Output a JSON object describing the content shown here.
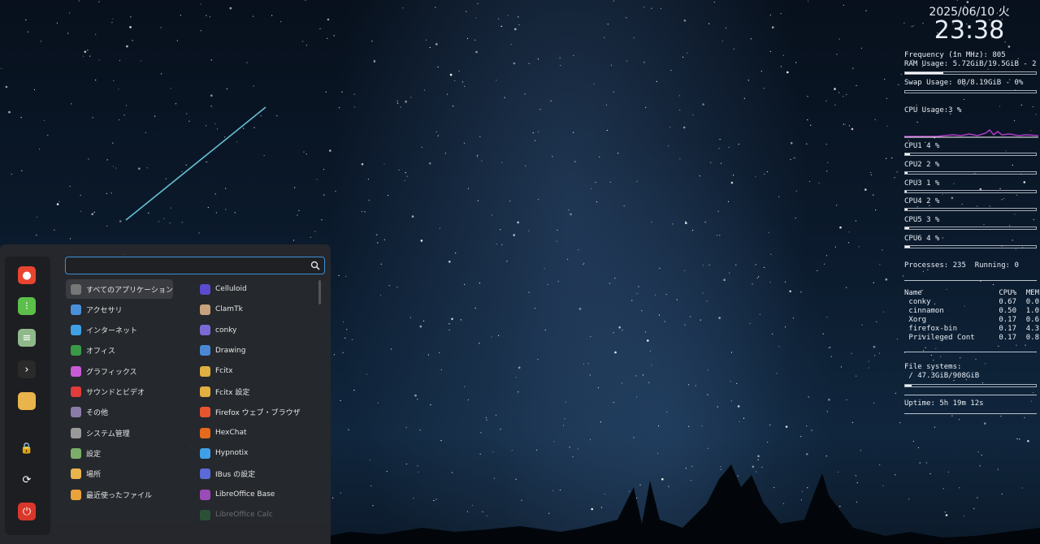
{
  "conky": {
    "date": "2025/06/10 火",
    "time": "23:38",
    "frequency": "Frequency (in MHz): 805",
    "ram": "RAM Usage: 5.72GiB/19.5GiB - 2",
    "ram_fraction": 0.29,
    "swap": "Swap Usage: 0B/8.19GiB - 0%",
    "swap_fraction": 0.0,
    "cpu_usage": "CPU Usage:3 %",
    "cores": [
      {
        "label": "CPU1 4 %",
        "fraction": 0.04
      },
      {
        "label": "CPU2 2 %",
        "fraction": 0.02
      },
      {
        "label": "CPU3 1 %",
        "fraction": 0.01
      },
      {
        "label": "CPU4 2 %",
        "fraction": 0.02
      },
      {
        "label": "CPU5 3 %",
        "fraction": 0.03
      },
      {
        "label": "CPU6 4 %",
        "fraction": 0.04
      }
    ],
    "processes": "Processes: 235  Running: 0",
    "proc_headers": [
      "Name",
      "CPU%",
      "MEM"
    ],
    "procs": [
      {
        "name": " conky",
        "cpu": "0.67",
        "mem": "0.0"
      },
      {
        "name": " cinnamon",
        "cpu": "0.50",
        "mem": "1.0"
      },
      {
        "name": " Xorg",
        "cpu": "0.17",
        "mem": "0.6"
      },
      {
        "name": " firefox-bin",
        "cpu": "0.17",
        "mem": "4.3"
      },
      {
        "name": " Privileged Cont",
        "cpu": "0.17",
        "mem": "0.8"
      }
    ],
    "filesystems": "File systems:",
    "root_fs": " / 47.3GiB/908GiB",
    "root_fraction": 0.05,
    "uptime": "Uptime: 5h 19m 12s"
  },
  "menu": {
    "search": {
      "value": "",
      "placeholder": ""
    },
    "favorites": [
      {
        "name": "firefox-icon",
        "color": "#e8442f",
        "glyph": "●"
      },
      {
        "name": "software-manager-icon",
        "color": "#5bbf4a",
        "glyph": "⁝"
      },
      {
        "name": "settings-icon",
        "color": "#8fb98a",
        "glyph": "≡"
      },
      {
        "name": "terminal-icon",
        "color": "#2a2a2a",
        "glyph": "›"
      },
      {
        "name": "folder-icon",
        "color": "#e9b44c",
        "glyph": ""
      },
      {
        "name": "lock-icon",
        "color": "transparent",
        "glyph": "🔒"
      },
      {
        "name": "logout-icon",
        "color": "transparent",
        "glyph": "⟳"
      },
      {
        "name": "power-icon",
        "color": "#d9372a",
        "glyph": "⏻"
      }
    ],
    "categories": [
      {
        "label": "すべてのアプリケーション",
        "color": "#777",
        "icon": "grid-icon"
      },
      {
        "label": "アクセサリ",
        "color": "#4a90d9",
        "icon": "accessories-icon"
      },
      {
        "label": "インターネット",
        "color": "#3fa0e6",
        "icon": "internet-icon"
      },
      {
        "label": "オフィス",
        "color": "#3a9a48",
        "icon": "office-icon"
      },
      {
        "label": "グラフィックス",
        "color": "#c85bd6",
        "icon": "graphics-icon"
      },
      {
        "label": "サウンドとビデオ",
        "color": "#e23b3b",
        "icon": "sound-video-icon"
      },
      {
        "label": "その他",
        "color": "#8a7ca8",
        "icon": "other-icon"
      },
      {
        "label": "システム管理",
        "color": "#9a9a9a",
        "icon": "system-admin-icon"
      },
      {
        "label": "設定",
        "color": "#7cae6a",
        "icon": "settings-category-icon"
      },
      {
        "label": "場所",
        "color": "#e9b44c",
        "icon": "places-icon"
      },
      {
        "label": "最近使ったファイル",
        "color": "#e9a23c",
        "icon": "recent-files-icon"
      }
    ],
    "apps": [
      {
        "label": "Celluloid",
        "color": "#5a4bd0",
        "icon": "celluloid-icon",
        "faded": false
      },
      {
        "label": "ClamTk",
        "color": "#c8a27a",
        "icon": "clamtk-icon",
        "faded": false
      },
      {
        "label": "conky",
        "color": "#7b6ad6",
        "icon": "conky-icon",
        "faded": false
      },
      {
        "label": "Drawing",
        "color": "#4a88d6",
        "icon": "drawing-icon",
        "faded": false
      },
      {
        "label": "Fcitx",
        "color": "#e0b040",
        "icon": "fcitx-icon",
        "faded": false
      },
      {
        "label": "Fcitx 設定",
        "color": "#e0b040",
        "icon": "fcitx-config-icon",
        "faded": false
      },
      {
        "label": "Firefox ウェブ・ブラウザ",
        "color": "#e8542f",
        "icon": "firefox-app-icon",
        "faded": false
      },
      {
        "label": "HexChat",
        "color": "#e46a1c",
        "icon": "hexchat-icon",
        "faded": false
      },
      {
        "label": "Hypnotix",
        "color": "#3fa0e6",
        "icon": "hypnotix-icon",
        "faded": false
      },
      {
        "label": "IBus の設定",
        "color": "#5b6ad6",
        "icon": "ibus-icon",
        "faded": false
      },
      {
        "label": "LibreOffice Base",
        "color": "#9b4bb8",
        "icon": "libreoffice-base-icon",
        "faded": false
      },
      {
        "label": "LibreOffice Calc",
        "color": "#3a9a48",
        "icon": "libreoffice-calc-icon",
        "faded": true
      }
    ]
  }
}
